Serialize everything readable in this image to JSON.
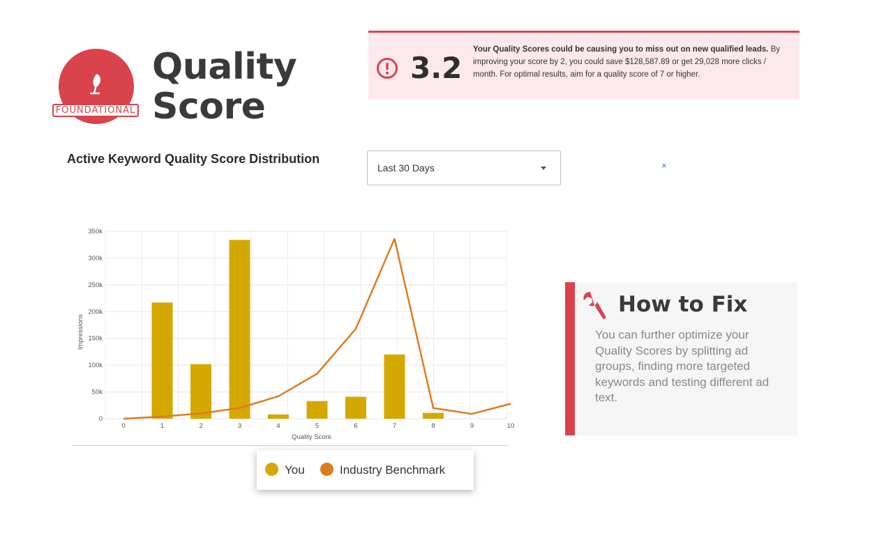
{
  "header": {
    "badge_label": "FOUNDATIONAL",
    "title": "Quality Score",
    "icon": "leaf-icon"
  },
  "alert": {
    "icon": "exclamation-circle-icon",
    "score": "3.2",
    "bold_text": "Your Quality Scores could be causing you to miss out on new qualified leads.",
    "body_text": " By improving your score by 2, you could save $128,587.89 or get 29,028 more clicks / month. For optimal results, aim for a quality score of 7 or higher."
  },
  "section": {
    "title": "Active Keyword Quality Score Distribution",
    "date_range": "Last 30 Days",
    "clear_label": "×"
  },
  "legend": {
    "you_label": "You",
    "benchmark_label": "Industry Benchmark"
  },
  "fix": {
    "title": "How to Fix",
    "body": "You can further optimize your Quality Scores by splitting ad groups, finding more targeted keywords and testing different ad text.",
    "icon": "wrench-icon"
  },
  "colors": {
    "accent": "#d9434c",
    "alert_bg": "#fde9ec",
    "bar": "#d4a800",
    "line": "#e07a1f",
    "link": "#3b6fd1"
  },
  "chart_data": {
    "type": "bar",
    "xlabel": "Quality Score",
    "ylabel": "Impressions",
    "categories": [
      "0",
      "1",
      "2",
      "3",
      "4",
      "5",
      "6",
      "7",
      "8",
      "9",
      "10"
    ],
    "x_tick_labels": [
      "0",
      "1",
      "2",
      "3",
      "4",
      "5",
      "6",
      "7",
      "8",
      "9",
      "10"
    ],
    "y_tick_labels": [
      "0",
      "50k",
      "100k",
      "150k",
      "200k",
      "250k",
      "300k",
      "350k"
    ],
    "ylim": [
      0,
      350000
    ],
    "grid": true,
    "series": [
      {
        "name": "You",
        "type": "bar",
        "color": "#d4a800",
        "values": [
          0,
          217000,
          102000,
          334000,
          8000,
          33000,
          41000,
          120000,
          11000,
          0,
          0
        ]
      },
      {
        "name": "Industry Benchmark",
        "type": "line",
        "color": "#e07a1f",
        "values": [
          0,
          4000,
          10000,
          20000,
          42000,
          84000,
          168000,
          336000,
          20000,
          9000,
          28000
        ]
      }
    ]
  }
}
